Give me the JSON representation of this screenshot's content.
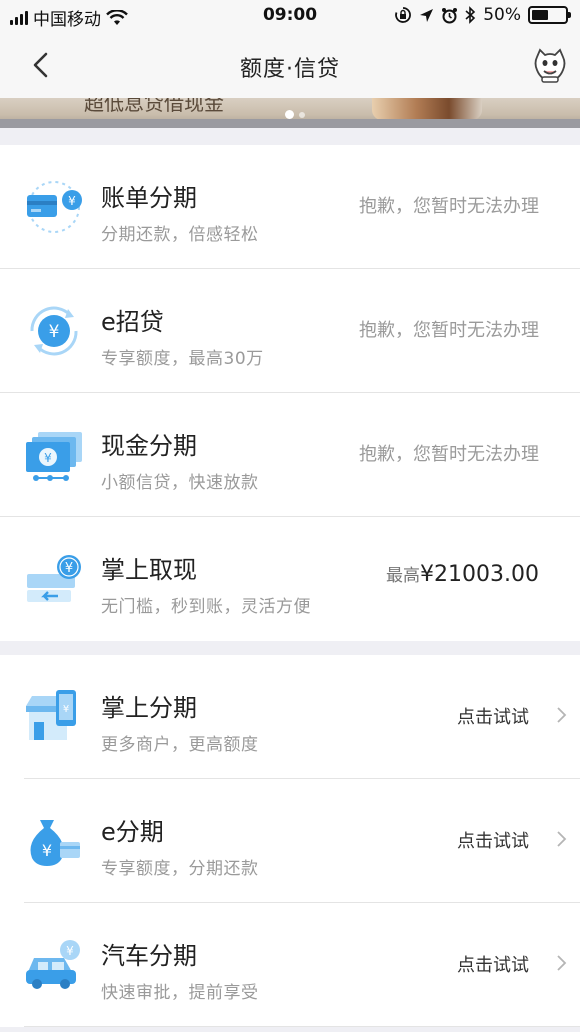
{
  "status_bar": {
    "carrier": "中国移动",
    "time": "09:00",
    "battery_percent": "50%",
    "battery_level": 0.5
  },
  "nav": {
    "title": "额度·信贷",
    "back_icon": "chevron-left-icon",
    "mascot_icon": "mascot-avatar-icon"
  },
  "banner": {
    "text": "超低息贷借现金"
  },
  "loans": [
    {
      "name": "账单分期",
      "desc": "分期还款，倍感轻松",
      "status": "抱歉，您暂时无法办理",
      "icon": "bill-card-icon"
    },
    {
      "name": "e招贷",
      "desc": "专享额度，最高30万",
      "status": "抱歉，您暂时无法办理",
      "icon": "yuan-cycle-icon"
    },
    {
      "name": "现金分期",
      "desc": "小额信贷，快速放款",
      "status": "抱歉，您暂时无法办理",
      "icon": "cash-notes-icon"
    }
  ],
  "cash": {
    "name": "掌上取现",
    "desc": "无门槛，秒到账，灵活方便",
    "amount_prefix": "最高",
    "amount": "¥21003.00",
    "icon": "cash-withdraw-icon"
  },
  "installments": [
    {
      "name": "掌上分期",
      "desc": "更多商户，更高额度",
      "action": "点击试试",
      "icon": "store-phone-icon"
    },
    {
      "name": "e分期",
      "desc": "专享额度，分期还款",
      "action": "点击试试",
      "icon": "money-bag-icon"
    },
    {
      "name": "汽车分期",
      "desc": "快速审批，提前享受",
      "action": "点击试试",
      "icon": "car-icon"
    }
  ],
  "colors": {
    "accent_blue": "#3a9ee8",
    "light_blue": "#a9d6f7",
    "text_gray": "#9a9a9a",
    "background": "#efeff4"
  }
}
